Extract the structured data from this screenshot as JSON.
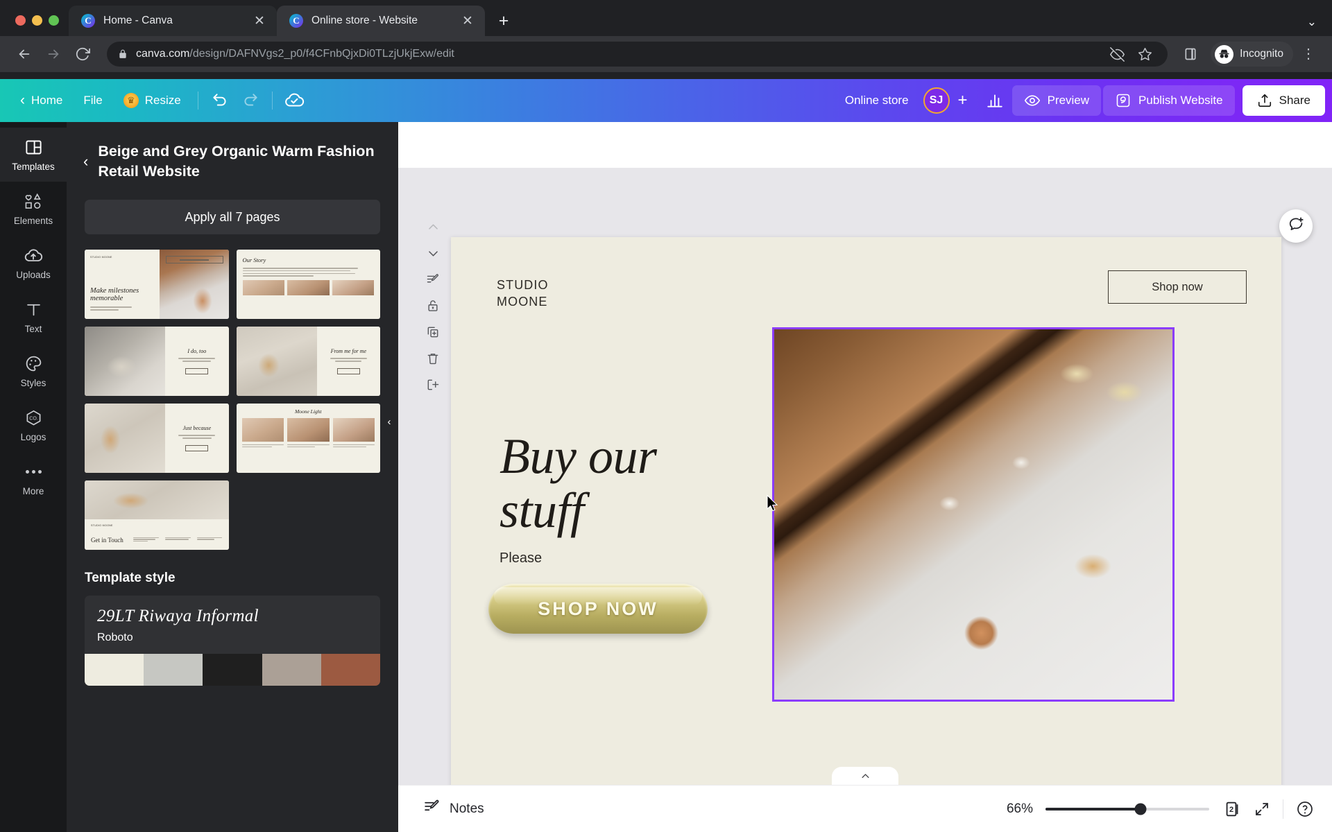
{
  "browser": {
    "tabs": [
      {
        "title": "Home - Canva",
        "favicon": "canva-icon",
        "active": false
      },
      {
        "title": "Online store - Website",
        "favicon": "canva-icon",
        "active": true
      }
    ],
    "new_tab_label": "+",
    "tab_list_chevron": "⌄",
    "close_label": "✕",
    "url_prefix": "canva.com",
    "url_suffix": "/design/DAFNVgs2_p0/f4CFnbQjxDi0TLzjUkjExw/edit",
    "profile_label": "Incognito",
    "kebab_label": "⋮"
  },
  "canva_header": {
    "back_label": "‹",
    "home_label": "Home",
    "file_label": "File",
    "resize_label": "Resize",
    "doc_name": "Online store",
    "avatar_initials": "SJ",
    "avatar_plus": "+",
    "preview_label": "Preview",
    "publish_label": "Publish Website",
    "share_label": "Share"
  },
  "sidebar": {
    "items": [
      {
        "label": "Templates",
        "icon": "templates-icon",
        "active": true
      },
      {
        "label": "Elements",
        "icon": "elements-icon",
        "active": false
      },
      {
        "label": "Uploads",
        "icon": "uploads-icon",
        "active": false
      },
      {
        "label": "Text",
        "icon": "text-icon",
        "active": false
      },
      {
        "label": "Styles",
        "icon": "styles-icon",
        "active": false
      },
      {
        "label": "Logos",
        "icon": "logos-icon",
        "active": false
      },
      {
        "label": "More",
        "icon": "more-icon",
        "active": false
      }
    ]
  },
  "panel": {
    "back_label": "‹",
    "title": "Beige and Grey Organic Warm Fashion Retail Website",
    "apply_label": "Apply all 7 pages",
    "thumbnails": [
      {
        "name": "hero-make-milestones",
        "heading": "Make milestones memorable",
        "logo": "STUDIO MOONE"
      },
      {
        "name": "our-story",
        "heading": "Our Story"
      },
      {
        "name": "i-do-too",
        "heading": "I do, too"
      },
      {
        "name": "from-me-for-me",
        "heading": "From me for me"
      },
      {
        "name": "just-because",
        "heading": "Just because"
      },
      {
        "name": "moone-light",
        "heading": "Moone Light"
      },
      {
        "name": "get-in-touch",
        "heading": "Get in Touch",
        "logo": "STUDIO MOONE"
      }
    ],
    "style_section_label": "Template style",
    "font_heading": "29LT Riwaya Informal",
    "font_body": "Roboto",
    "swatches": [
      "#eeece0",
      "#c6c7c2",
      "#1f1f1f",
      "#aba096",
      "#9c5a41"
    ]
  },
  "page": {
    "logo_line1": "STUDIO",
    "logo_line2": "MOONE",
    "shop_now_outline": "Shop now",
    "headline_line1": "Buy our",
    "headline_line2": "stuff",
    "subtext": "Please",
    "cta_label": "SHOP NOW",
    "photo_alt": "rose-gold-necklaces-photo",
    "selection_color": "#8b3dff"
  },
  "page_toolbar": {
    "items": [
      {
        "name": "scroll-up-icon",
        "label": "⌃"
      },
      {
        "name": "scroll-down-icon",
        "label": "⌄"
      },
      {
        "name": "notes-icon",
        "label": ""
      },
      {
        "name": "lock-icon",
        "label": ""
      },
      {
        "name": "duplicate-page-icon",
        "label": ""
      },
      {
        "name": "delete-page-icon",
        "label": ""
      },
      {
        "name": "add-page-icon",
        "label": ""
      }
    ]
  },
  "bottom_bar": {
    "notes_label": "Notes",
    "zoom_level": "66%",
    "page_count": "2",
    "help_label": "?"
  }
}
